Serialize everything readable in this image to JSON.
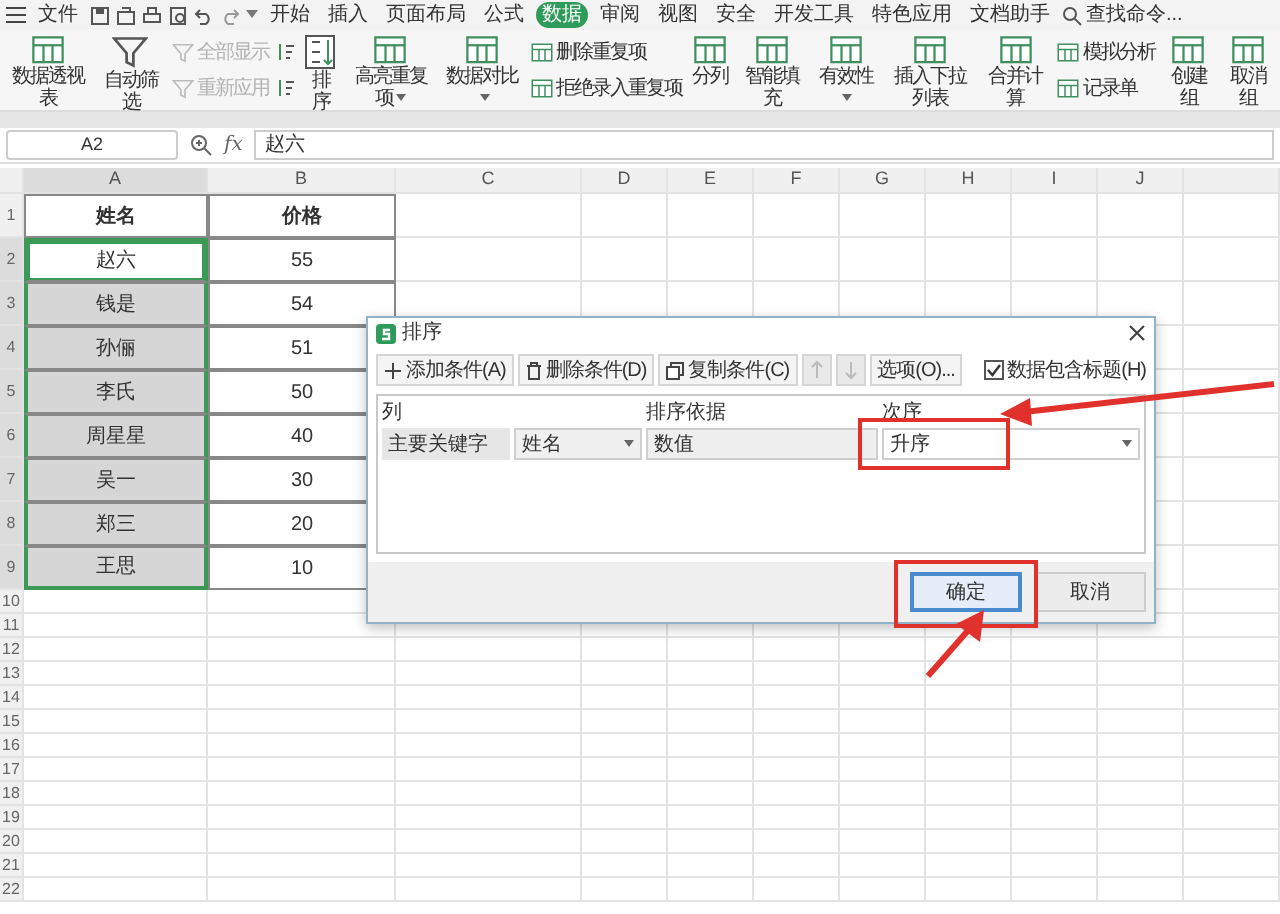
{
  "menu_bar": {
    "tabs": [
      {
        "label": "文件",
        "selected": false
      },
      {
        "label": "开始",
        "selected": false
      },
      {
        "label": "插入",
        "selected": false
      },
      {
        "label": "页面布局",
        "selected": false
      },
      {
        "label": "公式",
        "selected": false
      },
      {
        "label": "数据",
        "selected": true
      },
      {
        "label": "审阅",
        "selected": false
      },
      {
        "label": "视图",
        "selected": false
      },
      {
        "label": "安全",
        "selected": false
      },
      {
        "label": "开发工具",
        "selected": false
      },
      {
        "label": "特色应用",
        "selected": false
      },
      {
        "label": "文档助手",
        "selected": false
      }
    ],
    "search": {
      "placeholder": "查找命令..."
    }
  },
  "ribbon": [
    {
      "kind": "large",
      "label": "数据透视表",
      "dropdown": false
    },
    {
      "kind": "filter",
      "label": "自动筛选",
      "dropdown": false
    },
    {
      "kind": "stack",
      "items": [
        {
          "kind": "filter",
          "label": "全部显示",
          "disabled": true
        },
        {
          "kind": "filter",
          "label": "重新应用",
          "disabled": true
        }
      ]
    },
    {
      "kind": "sort",
      "label": "排序",
      "dropdown": false
    },
    {
      "kind": "large",
      "label": "高亮重复项",
      "dropdown": true
    },
    {
      "kind": "large",
      "label": "数据对比",
      "dropdown": true
    },
    {
      "kind": "stack",
      "items": [
        {
          "kind": "table",
          "label": "删除重复项",
          "disabled": false
        },
        {
          "kind": "table",
          "label": "拒绝录入重复项",
          "disabled": false
        }
      ]
    },
    {
      "kind": "large",
      "label": "分列",
      "dropdown": false
    },
    {
      "kind": "large",
      "label": "智能填充",
      "dropdown": false
    },
    {
      "kind": "large",
      "label": "有效性",
      "dropdown": true
    },
    {
      "kind": "large",
      "label": "插入下拉列表",
      "dropdown": false
    },
    {
      "kind": "large",
      "label": "合并计算",
      "dropdown": false
    },
    {
      "kind": "stack",
      "items": [
        {
          "kind": "table",
          "label": "模拟分析",
          "disabled": false
        },
        {
          "kind": "table",
          "label": "记录单",
          "disabled": false
        }
      ]
    },
    {
      "kind": "large",
      "label": "创建组",
      "dropdown": false
    },
    {
      "kind": "large",
      "label": "取消组",
      "dropdown": false
    }
  ],
  "formula_bar": {
    "name_box": "A2",
    "function_label": "fx",
    "value": "赵六"
  },
  "sheet": {
    "columns": [
      {
        "label": "A",
        "selected": true
      },
      {
        "label": "B",
        "selected": false
      },
      {
        "label": "C",
        "selected": false
      },
      {
        "label": "D",
        "selected": false
      },
      {
        "label": "E",
        "selected": false
      },
      {
        "label": "F",
        "selected": false
      },
      {
        "label": "G",
        "selected": false
      },
      {
        "label": "H",
        "selected": false
      },
      {
        "label": "I",
        "selected": false
      },
      {
        "label": "J",
        "selected": false
      }
    ],
    "rows": [
      {
        "number": "1",
        "cells": [
          "姓名",
          "价格"
        ],
        "header": true,
        "selected": false,
        "active": false
      },
      {
        "number": "2",
        "cells": [
          "赵六",
          "55"
        ],
        "header": false,
        "selected": true,
        "active": true
      },
      {
        "number": "3",
        "cells": [
          "钱是",
          "54"
        ],
        "header": false,
        "selected": true,
        "active": false
      },
      {
        "number": "4",
        "cells": [
          "孙俪",
          "51"
        ],
        "header": false,
        "selected": true,
        "active": false
      },
      {
        "number": "5",
        "cells": [
          "李氏",
          "50"
        ],
        "header": false,
        "selected": true,
        "active": false
      },
      {
        "number": "6",
        "cells": [
          "周星星",
          "40"
        ],
        "header": false,
        "selected": true,
        "active": false
      },
      {
        "number": "7",
        "cells": [
          "吴一",
          "30"
        ],
        "header": false,
        "selected": true,
        "active": false
      },
      {
        "number": "8",
        "cells": [
          "郑三",
          "20"
        ],
        "header": false,
        "selected": true,
        "active": false
      },
      {
        "number": "9",
        "cells": [
          "王思",
          "10"
        ],
        "header": false,
        "selected": true,
        "active": false
      }
    ],
    "empty_rows": [
      "10",
      "11",
      "12",
      "13",
      "14",
      "15",
      "16",
      "17",
      "18",
      "19",
      "20",
      "21",
      "22"
    ]
  },
  "dialog": {
    "title": "排序",
    "toolbar": [
      {
        "kind": "add",
        "label": "添加条件(A)",
        "disabled": false
      },
      {
        "kind": "delete",
        "label": "删除条件(D)",
        "disabled": false
      },
      {
        "kind": "copy",
        "label": "复制条件(C)",
        "disabled": false
      },
      {
        "kind": "move_up",
        "disabled": true
      },
      {
        "kind": "move_down",
        "disabled": true
      },
      {
        "kind": "text",
        "label": "选项(O)...",
        "disabled": false
      }
    ],
    "header_checkbox": {
      "label": "数据包含标题(H)",
      "checked": true
    },
    "columns": [
      "列",
      "排序依据",
      "次序"
    ],
    "conditions": [
      {
        "key_label": "主要关键字",
        "column": "姓名",
        "sort_on": "数值",
        "order": "升序"
      }
    ],
    "buttons": [
      {
        "label": "确定",
        "default": true
      },
      {
        "label": "取消",
        "default": false
      }
    ]
  }
}
